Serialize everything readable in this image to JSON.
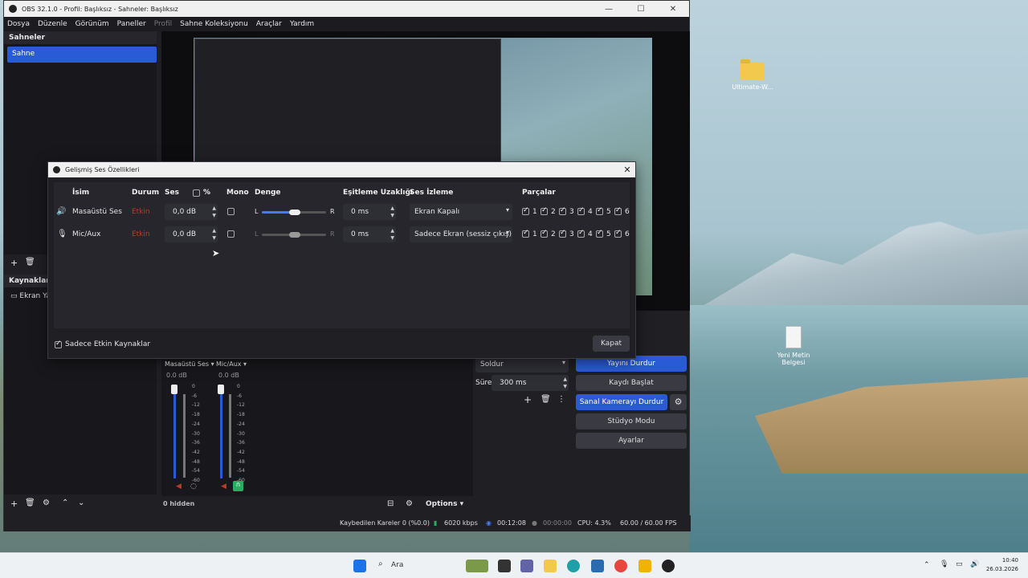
{
  "desktop": {
    "icons": [
      {
        "label": "Ultimate-W..."
      },
      {
        "label": "Yeni Metin Belgesi"
      }
    ]
  },
  "obs": {
    "title": "OBS 32.1.0 - Profil: Başlıksız - Sahneler: Başlıksız",
    "menu": [
      "Dosya",
      "Düzenle",
      "Görünüm",
      "Paneller",
      "Profil",
      "Sahne Koleksiyonu",
      "Araçlar",
      "Yardım"
    ],
    "scenes_title": "Sahneler",
    "scene_item": "Sahne",
    "sources_title": "Kaynaklar",
    "source_item": "Ekran Ya",
    "mixer": {
      "channels": [
        {
          "name": "Masaüstü Ses",
          "db": "0.0 dB"
        },
        {
          "name": "Mic/Aux",
          "db": "0.0 dB"
        }
      ],
      "scale": [
        "0",
        "-6",
        "-12",
        "-18",
        "-24",
        "-30",
        "-36",
        "-42",
        "-48",
        "-54",
        "-60"
      ],
      "hidden_label": "0 hidden",
      "options_label": "Options"
    },
    "transition": {
      "type": "Soldur",
      "duration_label": "Süre",
      "duration": "300 ms"
    },
    "controls": {
      "stop_stream": "Yayını Durdur",
      "start_record": "Kaydı Başlat",
      "stop_vcam": "Sanal Kamerayı Durdur",
      "studio_mode": "Stüdyo Modu",
      "settings": "Ayarlar"
    },
    "status": {
      "dropped": "Kaybedilen Kareler 0 (%0.0)",
      "bitrate": "6020 kbps",
      "stream_time": "00:12:08",
      "rec_time": "00:00:00",
      "cpu": "CPU: 4.3%",
      "fps": "60.00 / 60.00 FPS"
    }
  },
  "dialog": {
    "title": "Gelişmiş Ses Özellikleri",
    "headers": {
      "name": "İsim",
      "status": "Durum",
      "volume": "Ses",
      "percent": "%",
      "mono": "Mono",
      "balance": "Denge",
      "sync": "Eşitleme Uzaklığı",
      "monitor": "Ses İzleme",
      "tracks": "Parçalar"
    },
    "rows": [
      {
        "name": "Masaüstü Ses",
        "status": "Etkin",
        "volume": "0,0 dB",
        "balance_l": "L",
        "balance_r": "R",
        "sync": "0 ms",
        "monitor": "Ekran Kapalı",
        "tracks": [
          "1",
          "2",
          "3",
          "4",
          "5",
          "6"
        ]
      },
      {
        "name": "Mic/Aux",
        "status": "Etkin",
        "volume": "0,0 dB",
        "balance_l": "L",
        "balance_r": "R",
        "sync": "0 ms",
        "monitor": "Sadece Ekran (sessiz çıkış)",
        "tracks": [
          "1",
          "2",
          "3",
          "4",
          "5",
          "6"
        ]
      }
    ],
    "active_only_label": "Sadece Etkin Kaynaklar",
    "close_label": "Kapat"
  },
  "taskbar": {
    "search_placeholder": "Ara",
    "time": "10:40",
    "date": "26.03.2026"
  },
  "colors": {
    "accent": "#2a5bd7",
    "status_red": "#c0392b",
    "panel_bg": "#1f1f24"
  }
}
